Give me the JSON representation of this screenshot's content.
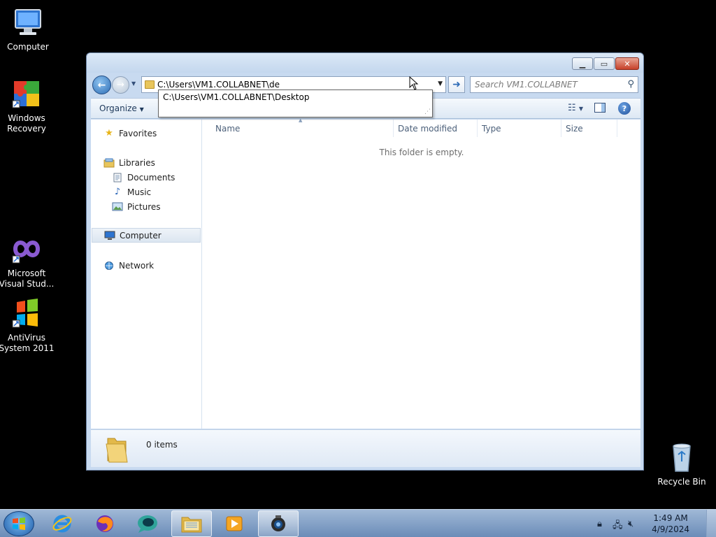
{
  "desktop": {
    "icons": [
      {
        "label": "Computer"
      },
      {
        "label": "Windows Recovery",
        "line1": "Windows",
        "line2": "Recovery"
      },
      {
        "label": "Microsoft Visual Stud...",
        "line1": "Microsoft",
        "line2": "Visual Stud..."
      },
      {
        "label": "AntiVirus System 2011",
        "line1": "AntiVirus",
        "line2": "System 2011"
      },
      {
        "label": "Recycle Bin"
      }
    ]
  },
  "explorer": {
    "address": {
      "value": "C:\\Users\\VM1.COLLABNET\\de"
    },
    "autocomplete": [
      "C:\\Users\\VM1.COLLABNET\\Desktop"
    ],
    "search": {
      "placeholder": "Search VM1.COLLABNET"
    },
    "toolbar": {
      "organize_label": "Organize"
    },
    "nav": {
      "favorites": "Favorites",
      "libraries": "Libraries",
      "documents": "Documents",
      "music": "Music",
      "pictures": "Pictures",
      "computer": "Computer",
      "network": "Network"
    },
    "columns": [
      "Name",
      "Date modified",
      "Type",
      "Size"
    ],
    "empty_message": "This folder is empty.",
    "details": {
      "item_count": "0 items"
    }
  },
  "taskbar": {
    "clock_time": "1:49 AM",
    "clock_date": "4/9/2024"
  },
  "colors": {
    "window_frame": "#c8daf0",
    "taskbar": "#6b8cb8",
    "accent": "#2f6cb7"
  }
}
